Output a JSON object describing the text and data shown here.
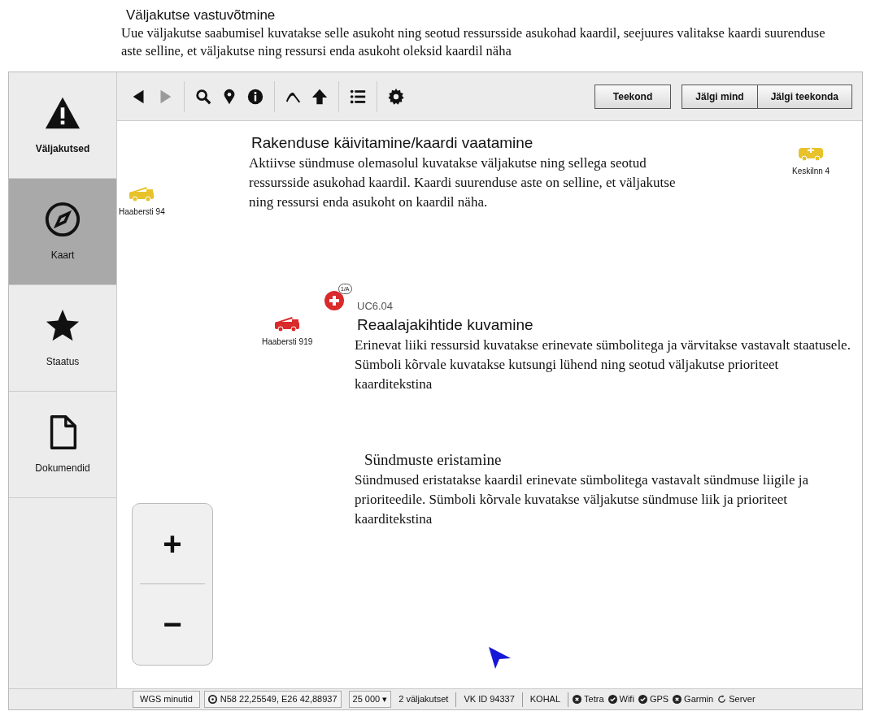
{
  "top_note": {
    "title": "Väljakutse vastuvõtmine",
    "text": "Uue väljakutse saabumisel kuvatakse selle asukoht ning seotud ressursside asukohad kaardil, seejuures valitakse kaardi suurenduse aste selline, et väljakutse ning ressursi enda asukoht oleksid kaardil näha"
  },
  "sidebar": {
    "items": [
      {
        "label": "Väljakutsed",
        "selected": false
      },
      {
        "label": "Kaart",
        "selected": true
      },
      {
        "label": "Staatus",
        "selected": false
      },
      {
        "label": "Dokumendid",
        "selected": false
      }
    ]
  },
  "toolbar": {
    "tools": [
      {
        "kind": "back",
        "disabled": false
      },
      {
        "kind": "forward",
        "disabled": true
      },
      {
        "kind": "search",
        "disabled": false
      },
      {
        "kind": "pin",
        "disabled": false
      },
      {
        "kind": "info",
        "disabled": false
      },
      {
        "kind": "curve",
        "disabled": false
      },
      {
        "kind": "up",
        "disabled": false
      },
      {
        "kind": "list",
        "disabled": false
      },
      {
        "kind": "settings",
        "disabled": false
      }
    ],
    "button": "Teekond",
    "button_group": [
      "Jälgi mind",
      "Jälgi teekonda"
    ]
  },
  "map": {
    "markers": [
      {
        "label": "Haabersti 94",
        "kind": "truck",
        "color": "#e8c22a"
      },
      {
        "label": "Keskilnn 4",
        "kind": "van",
        "color": "#e8c22a"
      },
      {
        "label": "Haabersti 919",
        "kind": "truck",
        "color": "#d92b2b"
      }
    ],
    "incident": {
      "badge": "1/A",
      "color": "#d92b2b"
    },
    "notes": [
      {
        "title": "Rakenduse käivitamine/kaardi vaatamine",
        "text": "Aktiivse sündmuse olemasolul kuvatakse väljakutse ning sellega seotud ressursside asukohad kaardil. Kaardi suurenduse aste on selline, et väljakutse ning ressursi enda asukoht on kaardil näha."
      },
      {
        "code": "UC6.04",
        "title": "Reaalajakihtide kuvamine",
        "text": "Erinevat liiki ressursid kuvatakse erinevate sümbolitega ja värvitakse vastavalt staatusele. Sümboli kõrvale kuvatakse kutsungi lühend ning seotud väljakutse prioriteet kaarditekstina"
      },
      {
        "title": "Sündmuste eristamine",
        "text": "Sündmused eristatakse kaardil erinevate sümbolitega vastavalt sündmuse liigile ja prioriteedile. Sümboli kõrvale kuvatakse väljakutse sündmuse liik ja prioriteet kaarditekstina"
      }
    ],
    "zoom": {
      "plus": "+",
      "minus": "−"
    }
  },
  "status_bar": [
    {
      "kind": "box",
      "text": "WGS minutid"
    },
    {
      "kind": "box_icon",
      "text": "N58 22,25549, E26 42,88937"
    },
    {
      "kind": "select",
      "text": "25 000 ▾"
    },
    {
      "kind": "text",
      "text": "2 väljakutset"
    },
    {
      "kind": "text",
      "text": "VK ID 94337"
    },
    {
      "kind": "text",
      "text": "KOHAL"
    },
    {
      "kind": "error",
      "text": "Tetra"
    },
    {
      "kind": "ok",
      "text": "Wifi"
    },
    {
      "kind": "ok",
      "text": "GPS"
    },
    {
      "kind": "error",
      "text": "Garmin"
    },
    {
      "kind": "pending",
      "text": "Server"
    }
  ]
}
